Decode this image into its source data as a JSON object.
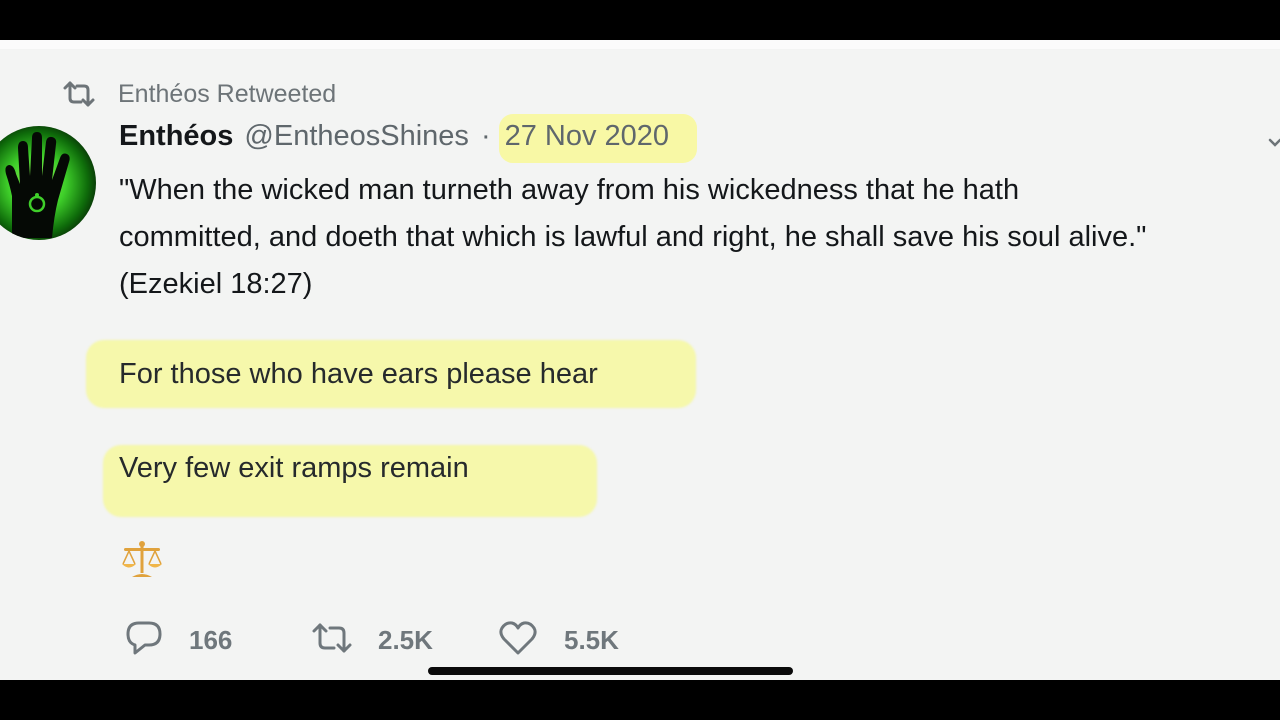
{
  "retweet_bar": {
    "label": "Enthéos Retweeted"
  },
  "tweet": {
    "display_name": "Enthéos",
    "handle": "@EntheosShines",
    "separator": "·",
    "date": "27 Nov 2020",
    "lines": [
      "\"When the wicked man turneth away from his wickedness that he hath",
      "committed, and doeth that which is lawful and right, he shall save his soul alive.\"",
      "(Ezekiel 18:27)"
    ],
    "line_hear": "For those who have ears please hear",
    "line_exit": "Very few exit ramps remain",
    "emoji": "⚖️"
  },
  "actions": {
    "replies": "166",
    "retweets": "2.5K",
    "likes": "5.5K"
  },
  "icons": {
    "retweet": "retweet-icon",
    "reply": "reply-icon",
    "like": "heart-icon",
    "more": "chevron-down-icon",
    "avatar": "green-hand-avatar",
    "scales": "balance-scale-icon"
  },
  "colors": {
    "highlight": "#f6f896",
    "text": "#14171a",
    "secondary": "#5f676c"
  }
}
